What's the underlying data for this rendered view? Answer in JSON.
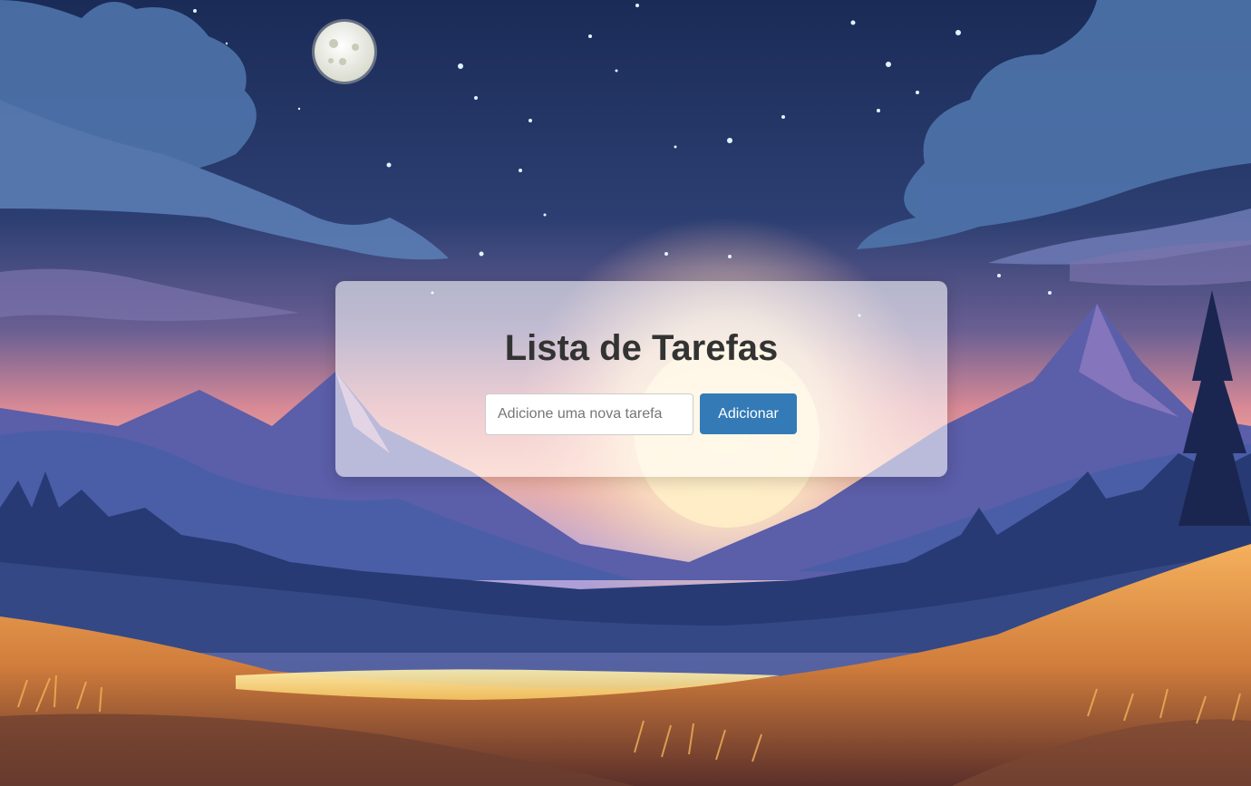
{
  "app": {
    "title": "Lista de Tarefas"
  },
  "form": {
    "input_placeholder": "Adicione uma nova tarefa",
    "input_value": "",
    "add_button_label": "Adicionar"
  },
  "colors": {
    "button": "#337ab7",
    "title": "#333333",
    "sky_top": "#1a2b57",
    "sunset": "#f08a7e",
    "field": "#e0914a"
  }
}
